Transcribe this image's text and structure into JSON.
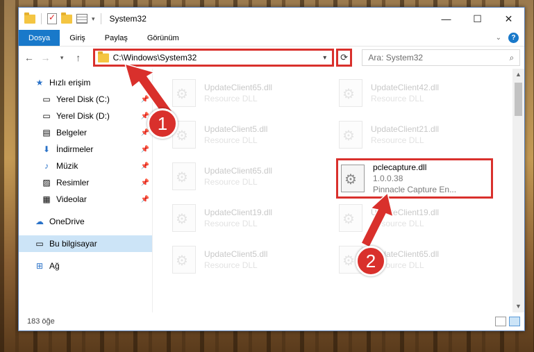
{
  "window": {
    "title": "System32",
    "controls": {
      "minimize": "—",
      "maximize": "☐",
      "close": "✕"
    }
  },
  "ribbon": {
    "tabs": [
      "Dosya",
      "Giriş",
      "Paylaş",
      "Görünüm"
    ]
  },
  "nav": {
    "address": "C:\\Windows\\System32",
    "search_placeholder": "Ara: System32"
  },
  "sidebar": {
    "items": [
      {
        "label": "Hızlı erişim",
        "icon": "star-icon",
        "pinned": false
      },
      {
        "label": "Yerel Disk (C:)",
        "icon": "drive-icon",
        "pinned": true
      },
      {
        "label": "Yerel Disk (D:)",
        "icon": "drive-icon",
        "pinned": true
      },
      {
        "label": "Belgeler",
        "icon": "document-icon",
        "pinned": true
      },
      {
        "label": "İndirmeler",
        "icon": "download-icon",
        "pinned": true
      },
      {
        "label": "Müzik",
        "icon": "music-icon",
        "pinned": true
      },
      {
        "label": "Resimler",
        "icon": "pictures-icon",
        "pinned": true
      },
      {
        "label": "Videolar",
        "icon": "video-icon",
        "pinned": true
      },
      {
        "label": "OneDrive",
        "icon": "cloud-icon"
      },
      {
        "label": "Bu bilgisayar",
        "icon": "computer-icon",
        "selected": true
      },
      {
        "label": "Ağ",
        "icon": "network-icon"
      }
    ]
  },
  "files": [
    {
      "name": "UpdateClient65.dll",
      "type": "Resource DLL"
    },
    {
      "name": "UpdateClient42.dll",
      "type": "Resource DLL"
    },
    {
      "name": "UpdateClient5.dll",
      "type": "Resource DLL"
    },
    {
      "name": "UpdateClient21.dll",
      "type": "Resource DLL"
    },
    {
      "name": "UpdateClient65.dll",
      "type": "Resource DLL"
    },
    {
      "name": "pclecapture.dll",
      "version": "1.0.0.38",
      "type": "Pinnacle Capture En...",
      "highlighted": true
    },
    {
      "name": "UpdateClient19.dll",
      "type": "Resource DLL"
    },
    {
      "name": "UpdateClient19.dll",
      "type": "Resource DLL"
    },
    {
      "name": "UpdateClient5.dll",
      "type": "Resource DLL"
    },
    {
      "name": "UpdateClient65.dll",
      "type": "Resource DLL"
    }
  ],
  "status": {
    "count": "183 öğe"
  },
  "annotations": {
    "step1": "1",
    "step2": "2"
  },
  "colors": {
    "accent": "#1979ca",
    "annotation": "#d9302c"
  }
}
